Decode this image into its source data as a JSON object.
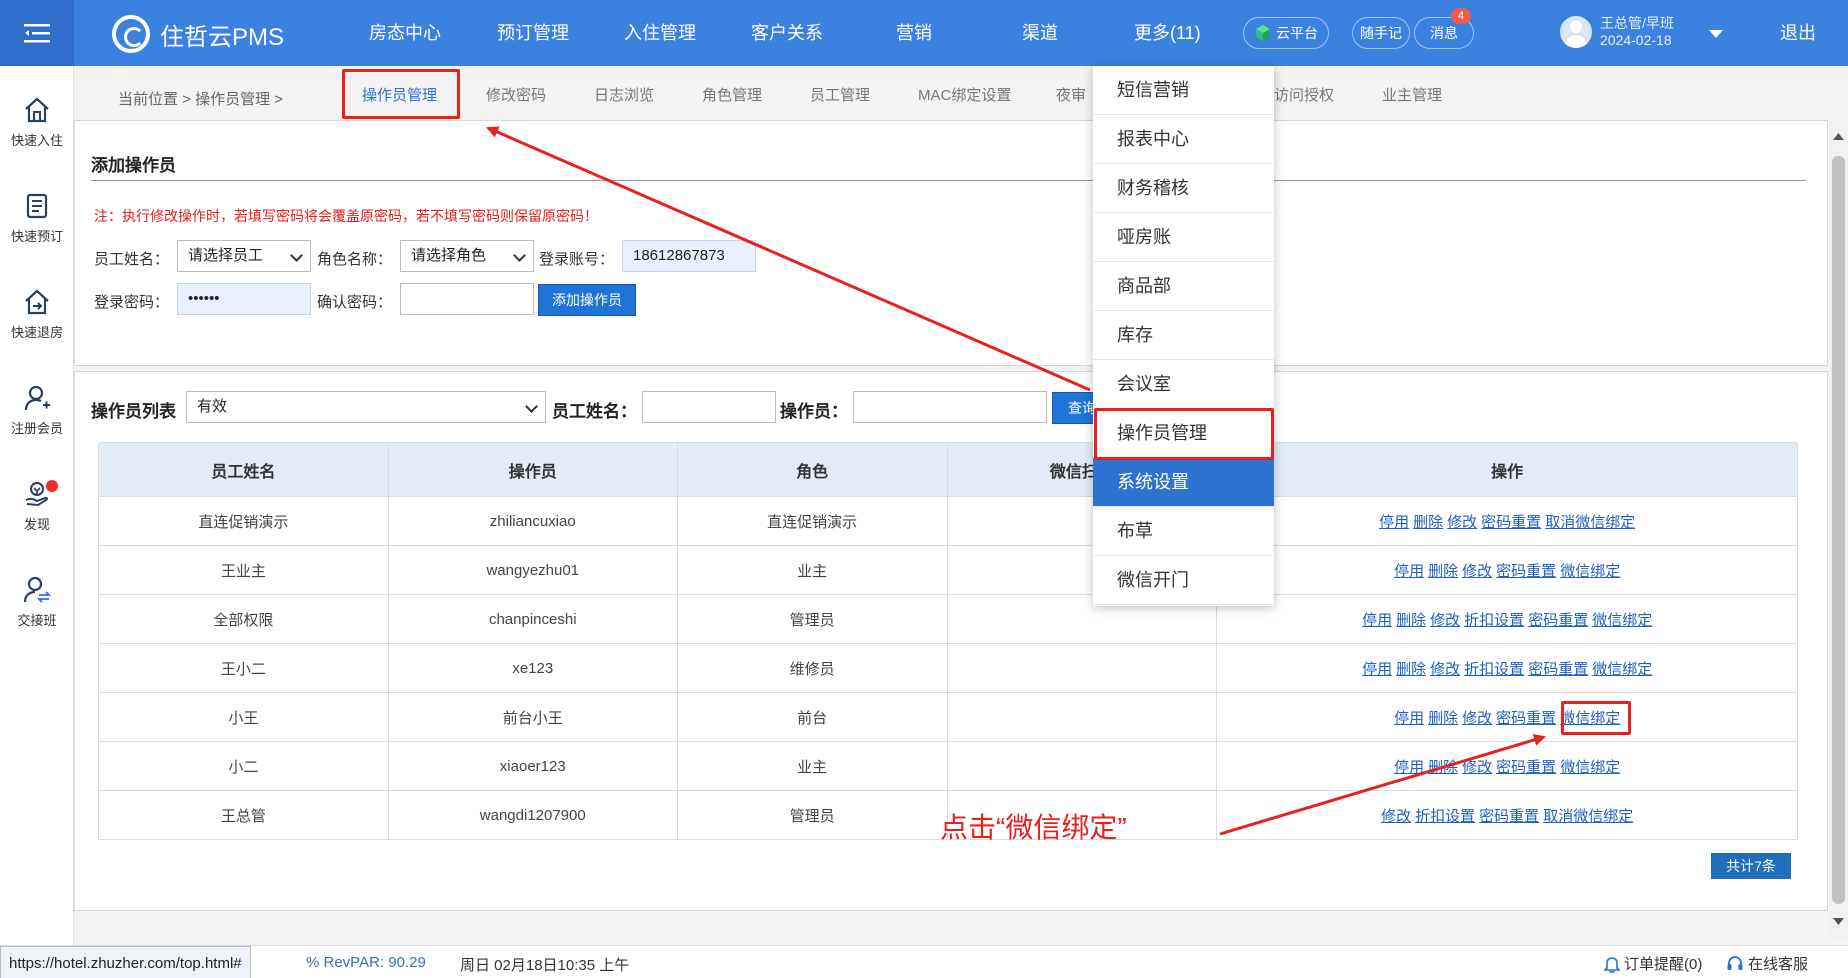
{
  "topbar": {
    "brand": "住哲云PMS",
    "nav": [
      "房态中心",
      "预订管理",
      "入住管理",
      "客户关系",
      "营销",
      "渠道",
      "更多(11)"
    ],
    "cloud_platform": "云平台",
    "notes": "随手记",
    "messages": "消息",
    "message_count": "4",
    "user_name": "王总管/早班",
    "user_date": "2024-02-18",
    "logout": "退出",
    "accent": "#3b82e0"
  },
  "sidebar": {
    "items": [
      {
        "label": "快速入住",
        "icon": "home-icon"
      },
      {
        "label": "快速预订",
        "icon": "document-icon"
      },
      {
        "label": "快速退房",
        "icon": "checkout-icon"
      },
      {
        "label": "注册会员",
        "icon": "user-add-icon"
      },
      {
        "label": "发现",
        "icon": "discover-icon"
      },
      {
        "label": "交接班",
        "icon": "handover-icon"
      }
    ]
  },
  "breadcrumb": {
    "prefix": "当前位置 > 操作员管理 >"
  },
  "tabs": [
    "操作员管理",
    "修改密码",
    "日志浏览",
    "角色管理",
    "员工管理",
    "MAC绑定设置",
    "夜审",
    "访问授权",
    "业主管理"
  ],
  "add_form": {
    "title": "添加操作员",
    "notice": "注：执行修改操作时，若填写密码将会覆盖原密码，若不填写密码则保留原密码！",
    "employee_label": "员工姓名：",
    "employee_value": "请选择员工",
    "role_label": "角色名称：",
    "role_value": "请选择角色",
    "account_label": "登录账号：",
    "account_value": "18612867873",
    "password_label": "登录密码：",
    "password_value": "••••••",
    "confirm_label": "确认密码：",
    "confirm_value": "",
    "submit": "添加操作员"
  },
  "list": {
    "title": "操作员列表",
    "status_value": "有效",
    "name_label": "员工姓名：",
    "operator_label": "操作员：",
    "query": "查询",
    "columns": [
      "员工姓名",
      "操作员",
      "角色",
      "微信扫码",
      "操作"
    ],
    "rows": [
      {
        "name": "直连促销演示",
        "operator": "zhiliancuxiao",
        "role": "直连促销演示",
        "wechat": "",
        "ops": [
          "停用",
          "删除",
          "修改",
          "密码重置",
          "取消微信绑定"
        ]
      },
      {
        "name": "王业主",
        "operator": "wangyezhu01",
        "role": "业主",
        "wechat": "",
        "ops": [
          "停用",
          "删除",
          "修改",
          "密码重置",
          "微信绑定"
        ]
      },
      {
        "name": "全部权限",
        "operator": "chanpinceshi",
        "role": "管理员",
        "wechat": "",
        "ops": [
          "停用",
          "删除",
          "修改",
          "折扣设置",
          "密码重置",
          "微信绑定"
        ]
      },
      {
        "name": "王小二",
        "operator": "xe123",
        "role": "维修员",
        "wechat": "",
        "ops": [
          "停用",
          "删除",
          "修改",
          "折扣设置",
          "密码重置",
          "微信绑定"
        ]
      },
      {
        "name": "小王",
        "operator": "前台小王",
        "role": "前台",
        "wechat": "",
        "ops": [
          "停用",
          "删除",
          "修改",
          "密码重置",
          "微信绑定"
        ]
      },
      {
        "name": "小二",
        "operator": "xiaoer123",
        "role": "业主",
        "wechat": "",
        "ops": [
          "停用",
          "删除",
          "修改",
          "密码重置",
          "微信绑定"
        ]
      },
      {
        "name": "王总管",
        "operator": "wangdi1207900",
        "role": "管理员",
        "wechat": "",
        "ops": [
          "修改",
          "折扣设置",
          "密码重置",
          "取消微信绑定"
        ]
      }
    ],
    "total": "共计7条"
  },
  "more_menu": {
    "items": [
      "短信营销",
      "报表中心",
      "财务稽核",
      "哑房账",
      "商品部",
      "库存",
      "会议室",
      "操作员管理",
      "系统设置",
      "布草",
      "微信开门"
    ],
    "selected": "系统设置"
  },
  "annotation": "点击“微信绑定”",
  "status": {
    "url": "https://hotel.zhuzher.com/top.html#",
    "revpar": "% RevPAR:  90.29",
    "datetime": "周日 02月18日10:35 上午",
    "order_reminder": "订单提醒(0)",
    "online_service": "在线客服"
  }
}
